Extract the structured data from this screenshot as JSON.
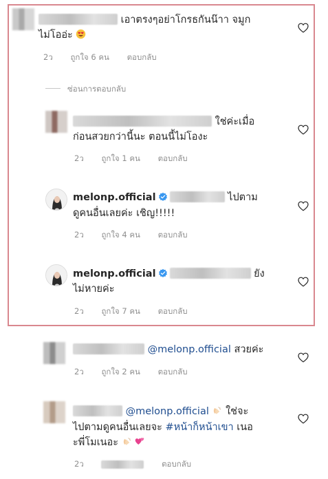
{
  "comments": [
    {
      "text_line1": "เอาตรงๆอย่าโกรธกันน๊าา  จมูก",
      "text_line2": "ไม่โออ่ะ",
      "time": "2ว",
      "likes": "ถูกใจ 6 คน",
      "reply": "ตอบกลับ"
    },
    {
      "text_line1": "ใช่ค่ะเมื่อ",
      "text_line2": "ก่อนสวยกว่านี้นะ ตอนนี้ไม่โองะ",
      "time": "2ว",
      "likes": "ถูกใจ 1 คน",
      "reply": "ตอบกลับ"
    },
    {
      "username": "melonp.official",
      "text_line1": "ไปตาม",
      "text_line2": "ดูคนอื่นเลยค่ะ เชิญ!!!!!",
      "time": "2ว",
      "likes": "ถูกใจ 4 คน",
      "reply": "ตอบกลับ"
    },
    {
      "username": "melonp.official",
      "text_line1": "ยัง",
      "text_line2": "ไม่หายค่ะ",
      "time": "2ว",
      "likes": "ถูกใจ 7 คน",
      "reply": "ตอบกลับ"
    },
    {
      "mention": "@melonp.official",
      "text_line1": "สวยค่ะ",
      "time": "2ว",
      "likes": "ถูกใจ 2 คน",
      "reply": "ตอบกลับ"
    },
    {
      "mention": "@melonp.official",
      "text_line1": "ใช่จะ",
      "text_line2_a": "ไปตามดูคนอื่นเลยจะ",
      "hashtag": "#หน้าก็หน้าเขา",
      "text_line2_b": "เนอ",
      "text_line3": "ะพี่โมเนอะ",
      "time": "2ว",
      "reply": "ตอบกลับ"
    }
  ],
  "hide_replies": "ซ่อนการตอบกลับ",
  "icons": [
    "heart-outline-icon",
    "verified-badge-icon",
    "heart-eyes-emoji",
    "clapping-hands-emoji",
    "two-hearts-emoji"
  ],
  "colors": {
    "highlight_border": "#d9878e",
    "link": "#1f4d8f",
    "meta_gray": "#8e8e8e"
  }
}
